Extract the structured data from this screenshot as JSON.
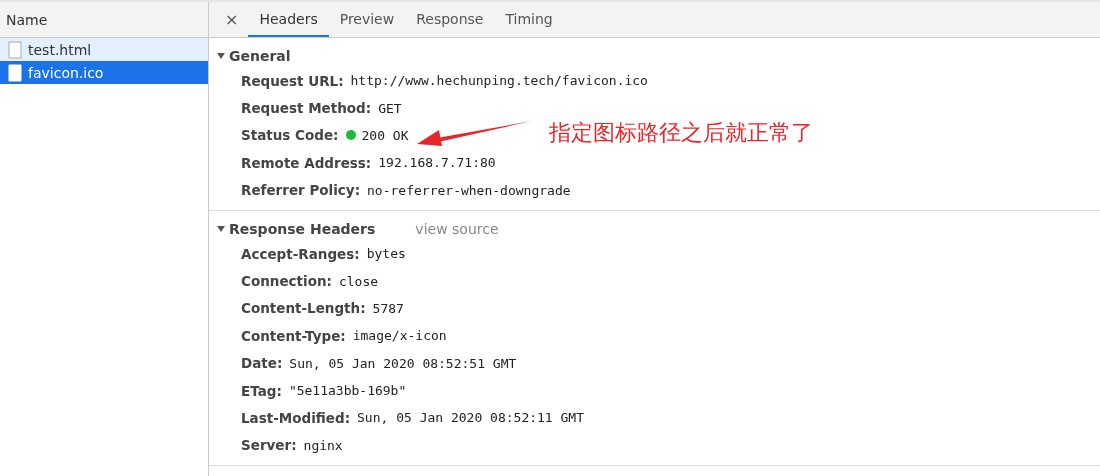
{
  "file_list": {
    "column": "Name",
    "files": [
      {
        "name": "test.html",
        "selected": false
      },
      {
        "name": "favicon.ico",
        "selected": true
      }
    ]
  },
  "details": {
    "close": "×",
    "tabs": [
      {
        "label": "Headers",
        "selected": true
      },
      {
        "label": "Preview",
        "selected": false
      },
      {
        "label": "Response",
        "selected": false
      },
      {
        "label": "Timing",
        "selected": false
      }
    ],
    "sections": [
      {
        "title": "General",
        "expanded": true,
        "rows": [
          {
            "name": "Request URL:",
            "value": "http://www.hechunping.tech/favicon.ico"
          },
          {
            "name": "Request Method:",
            "value": "GET"
          },
          {
            "name": "Status Code:",
            "value": "200 OK",
            "color": "#1fb83a"
          },
          {
            "name": "Remote Address:",
            "value": "192.168.7.71:80"
          },
          {
            "name": "Referrer Policy:",
            "value": "no-referrer-when-downgrade"
          }
        ]
      },
      {
        "title": "Response Headers",
        "link": "view source",
        "expanded": true,
        "rows": [
          {
            "name": "Accept-Ranges:",
            "value": "bytes"
          },
          {
            "name": "Connection:",
            "value": "close"
          },
          {
            "name": "Content-Length:",
            "value": "5787"
          },
          {
            "name": "Content-Type:",
            "value": "image/x-icon"
          },
          {
            "name": "Date:",
            "value": "Sun, 05 Jan 2020 08:52:51 GMT"
          },
          {
            "name": "ETag:",
            "value": "\"5e11a3bb-169b\""
          },
          {
            "name": "Last-Modified:",
            "value": "Sun, 05 Jan 2020 08:52:11 GMT"
          },
          {
            "name": "Server:",
            "value": "nginx"
          }
        ]
      }
    ]
  },
  "annotation": {
    "text": "指定图标路径之后就正常了"
  }
}
